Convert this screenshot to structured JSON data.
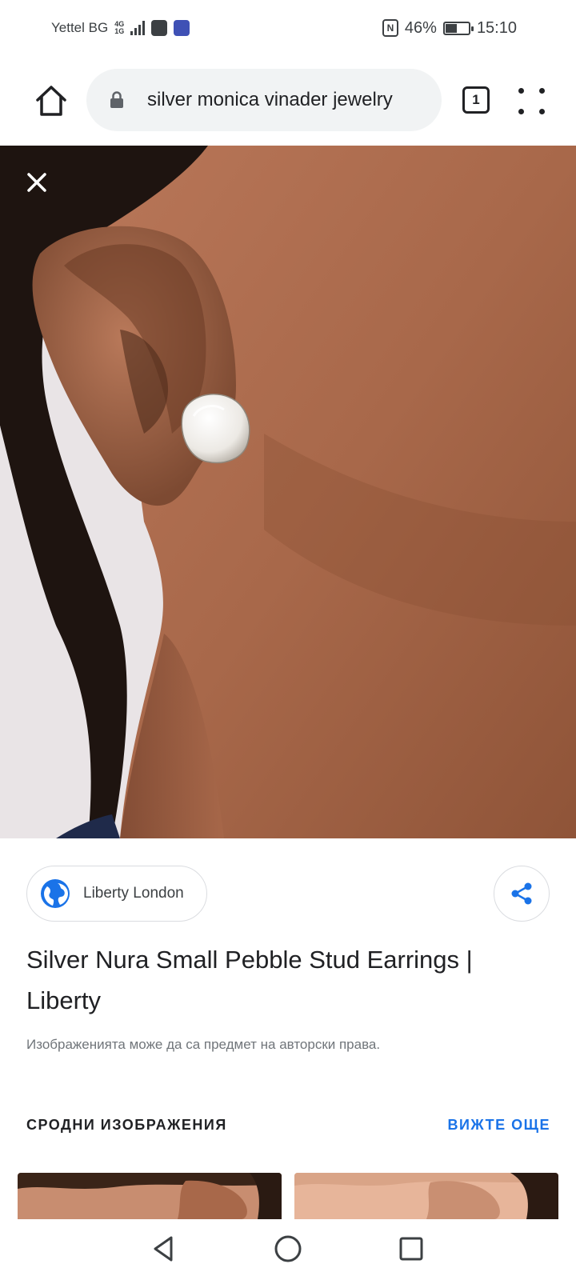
{
  "status_bar": {
    "carrier": "Yettel BG",
    "network_type_top": "4G",
    "network_type_bottom": "1G",
    "battery_percent_text": "46%",
    "battery_level": 0.46,
    "time": "15:10",
    "icons": [
      "signal-icon",
      "messaging-app-icon",
      "shield-app-icon",
      "nfc-icon",
      "battery-icon"
    ]
  },
  "browser": {
    "url_text": "silver monica vinader jewelry",
    "tab_count": "1",
    "icons": [
      "home-icon",
      "lock-icon",
      "tabs-icon",
      "menu-dots-icon"
    ]
  },
  "image_viewer": {
    "close_icon": "close-icon",
    "source": {
      "name": "Liberty London",
      "icon": "globe-icon"
    },
    "share_icon": "share-icon",
    "title": "Silver Nura Small Pebble Stud Earrings | Liberty",
    "copyright_note": "Изображенията може да са предмет на авторски права."
  },
  "related": {
    "heading": "СРОДНИ ИЗОБРАЖЕНИЯ",
    "see_more": "ВИЖТЕ ОЩЕ"
  },
  "colors": {
    "accent": "#1a73e8",
    "skin_mid": "#a8684a",
    "skin_dark": "#6e3e27",
    "hair": "#1e1410",
    "earring": "#ece9e4",
    "background_bg": "#e9e4e6"
  },
  "nav_bar": {
    "icons": [
      "back-icon",
      "home-circle-icon",
      "recents-icon"
    ]
  }
}
